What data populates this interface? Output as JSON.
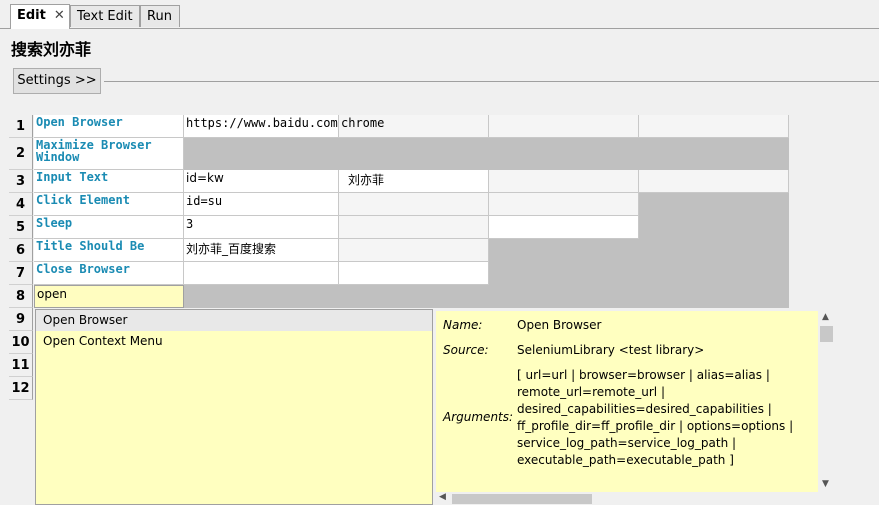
{
  "tabs": [
    {
      "label": "Edit",
      "close": "✕"
    },
    {
      "label": "Text Edit"
    },
    {
      "label": "Run"
    }
  ],
  "page_title": "搜索刘亦菲",
  "settings_label": "Settings >>",
  "rows": [
    {
      "num": "1",
      "keyword": "Open Browser",
      "args": [
        "https://www.baidu.com",
        "chrome",
        "",
        ""
      ]
    },
    {
      "num": "2",
      "keyword": "Maximize Browser Window",
      "args": []
    },
    {
      "num": "3",
      "keyword": "Input Text",
      "args": [
        "id=kw",
        "刘亦菲",
        ""
      ]
    },
    {
      "num": "4",
      "keyword": "Click Element",
      "args": [
        "id=su",
        "",
        ""
      ]
    },
    {
      "num": "5",
      "keyword": "Sleep",
      "args": [
        "3",
        ""
      ]
    },
    {
      "num": "6",
      "keyword": "Title Should Be",
      "args": [
        "刘亦菲_百度搜索",
        ""
      ]
    },
    {
      "num": "7",
      "keyword": "Close Browser",
      "args": []
    },
    {
      "num": "8",
      "keyword": "open",
      "args": [
        "",
        "",
        "",
        ""
      ]
    },
    {
      "num": "9"
    },
    {
      "num": "10"
    },
    {
      "num": "11"
    },
    {
      "num": "12"
    }
  ],
  "autocomplete": {
    "items": [
      "Open Browser",
      "Open Context Menu"
    ],
    "selected": "Open Browser"
  },
  "doc": {
    "name_label": "Name:",
    "name": "Open Browser",
    "source_label": "Source:",
    "source": "SeleniumLibrary <test library>",
    "arguments_label": "Arguments:",
    "arguments": "[ url=url | browser=browser | alias=alias | remote_url=remote_url | desired_capabilities=desired_capabilities | ff_profile_dir=ff_profile_dir | options=options | service_log_path=service_log_path | executable_path=executable_path ]"
  }
}
